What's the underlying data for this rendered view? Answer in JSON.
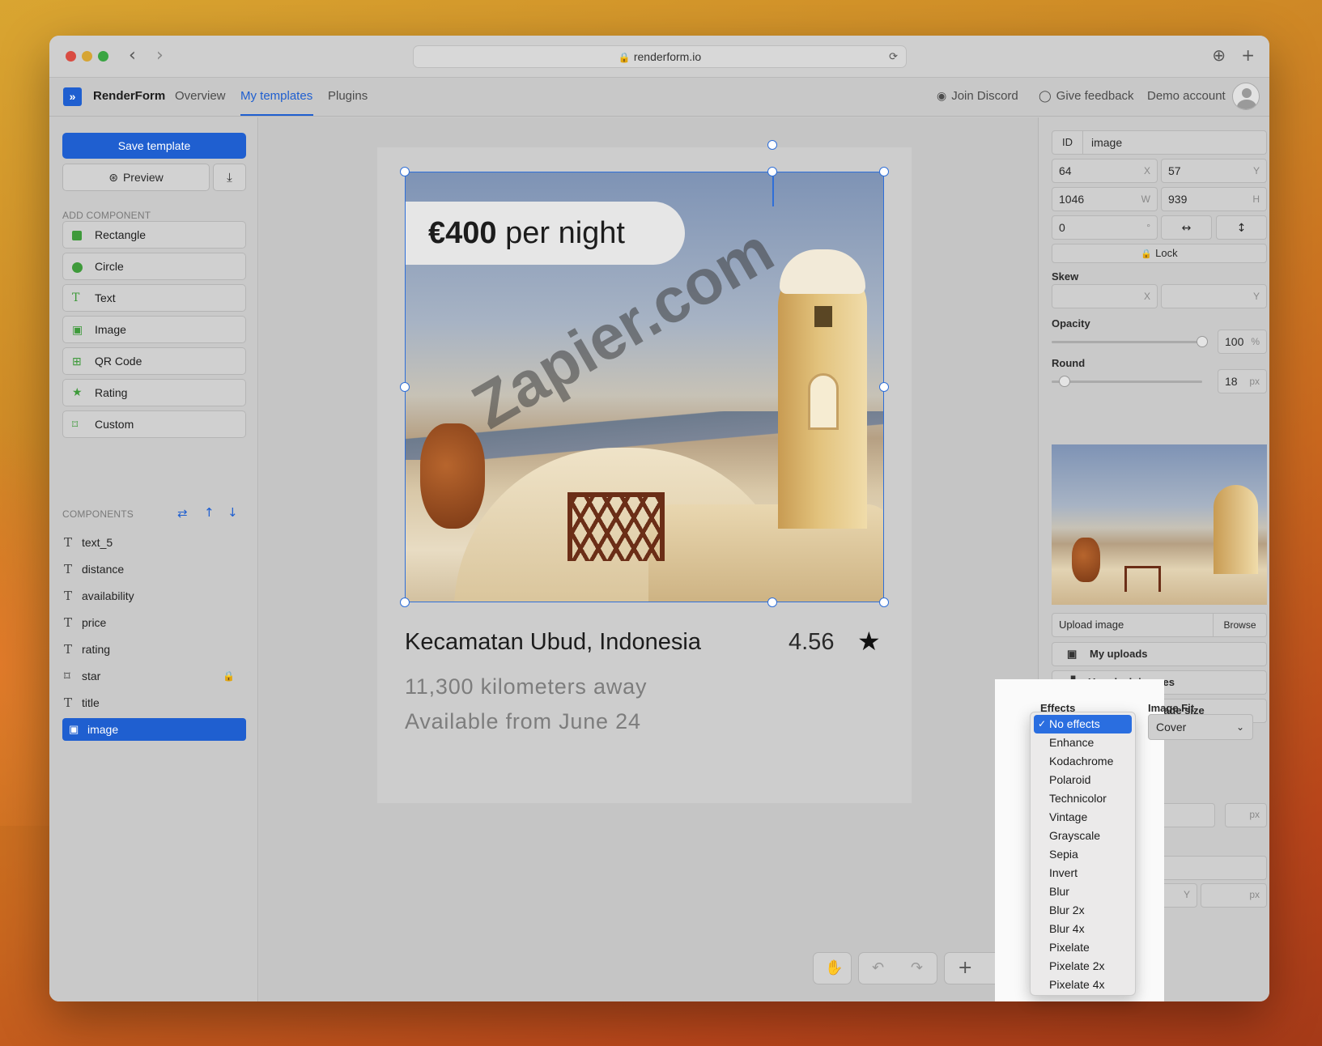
{
  "browser": {
    "url": "renderform.io"
  },
  "app": {
    "brand": "RenderForm",
    "nav": [
      {
        "label": "Overview"
      },
      {
        "label": "My templates"
      },
      {
        "label": "Plugins"
      }
    ],
    "active_nav": "My templates",
    "header_right": {
      "discord": "Join Discord",
      "feedback": "Give feedback",
      "account": "Demo account"
    }
  },
  "left_panel": {
    "save_label": "Save template",
    "preview_label": "Preview",
    "add_component_heading": "ADD COMPONENT",
    "add_components": [
      {
        "label": "Rectangle",
        "icon": "rectangle-icon"
      },
      {
        "label": "Circle",
        "icon": "circle-icon"
      },
      {
        "label": "Text",
        "icon": "text-icon"
      },
      {
        "label": "Image",
        "icon": "image-icon"
      },
      {
        "label": "QR Code",
        "icon": "qr-code-icon"
      },
      {
        "label": "Rating",
        "icon": "star-icon"
      },
      {
        "label": "Custom",
        "icon": "custom-shape-icon"
      }
    ],
    "components_heading": "COMPONENTS",
    "layers": [
      {
        "label": "text_5",
        "icon": "text-icon"
      },
      {
        "label": "distance",
        "icon": "text-icon"
      },
      {
        "label": "availability",
        "icon": "text-icon"
      },
      {
        "label": "price",
        "icon": "text-icon"
      },
      {
        "label": "rating",
        "icon": "text-icon"
      },
      {
        "label": "star",
        "icon": "custom-shape-icon",
        "locked": true
      },
      {
        "label": "title",
        "icon": "text-icon"
      },
      {
        "label": "image",
        "icon": "image-icon",
        "selected": true
      }
    ]
  },
  "canvas": {
    "price_bold": "€400",
    "price_rest": " per night",
    "watermark": "Zapier.com",
    "title": "Kecamatan Ubud, Indonesia",
    "rating": "4.56",
    "distance": "11,300 kilometers away",
    "availability": "Available from June 24"
  },
  "right_panel": {
    "id_label": "ID",
    "id_value": "image",
    "x_value": "64",
    "x_suffix": "X",
    "y_value": "57",
    "y_suffix": "Y",
    "w_value": "1046",
    "w_suffix": "W",
    "h_value": "939",
    "h_suffix": "H",
    "rotation_value": "0",
    "rotation_suffix": "°",
    "lock_label": "Lock",
    "skew_label": "Skew",
    "skew_x_suffix": "X",
    "skew_y_suffix": "Y",
    "opacity_label": "Opacity",
    "opacity_value": "100",
    "opacity_suffix": "%",
    "opacity_fraction": 1.0,
    "round_label": "Round",
    "round_value": "18",
    "round_suffix": "px",
    "upload_label": "Upload image",
    "browse_label": "Browse",
    "my_uploads_label": "My uploads",
    "unsplash_label": "Unsplash images",
    "original_size_label": "Use original image size",
    "effects_label": "Effects",
    "image_fit_label": "Image Fit",
    "image_fit_value": "Cover",
    "px_suffix": "px"
  },
  "effects_menu": {
    "selected": "No effects",
    "options": [
      "No effects",
      "Enhance",
      "Kodachrome",
      "Polaroid",
      "Technicolor",
      "Vintage",
      "Grayscale",
      "Sepia",
      "Invert",
      "Blur",
      "Blur 2x",
      "Blur 4x",
      "Pixelate",
      "Pixelate 2x",
      "Pixelate 4x"
    ]
  },
  "colors": {
    "accent": "#1f5fd0",
    "component_icon": "#3e9a3a"
  }
}
